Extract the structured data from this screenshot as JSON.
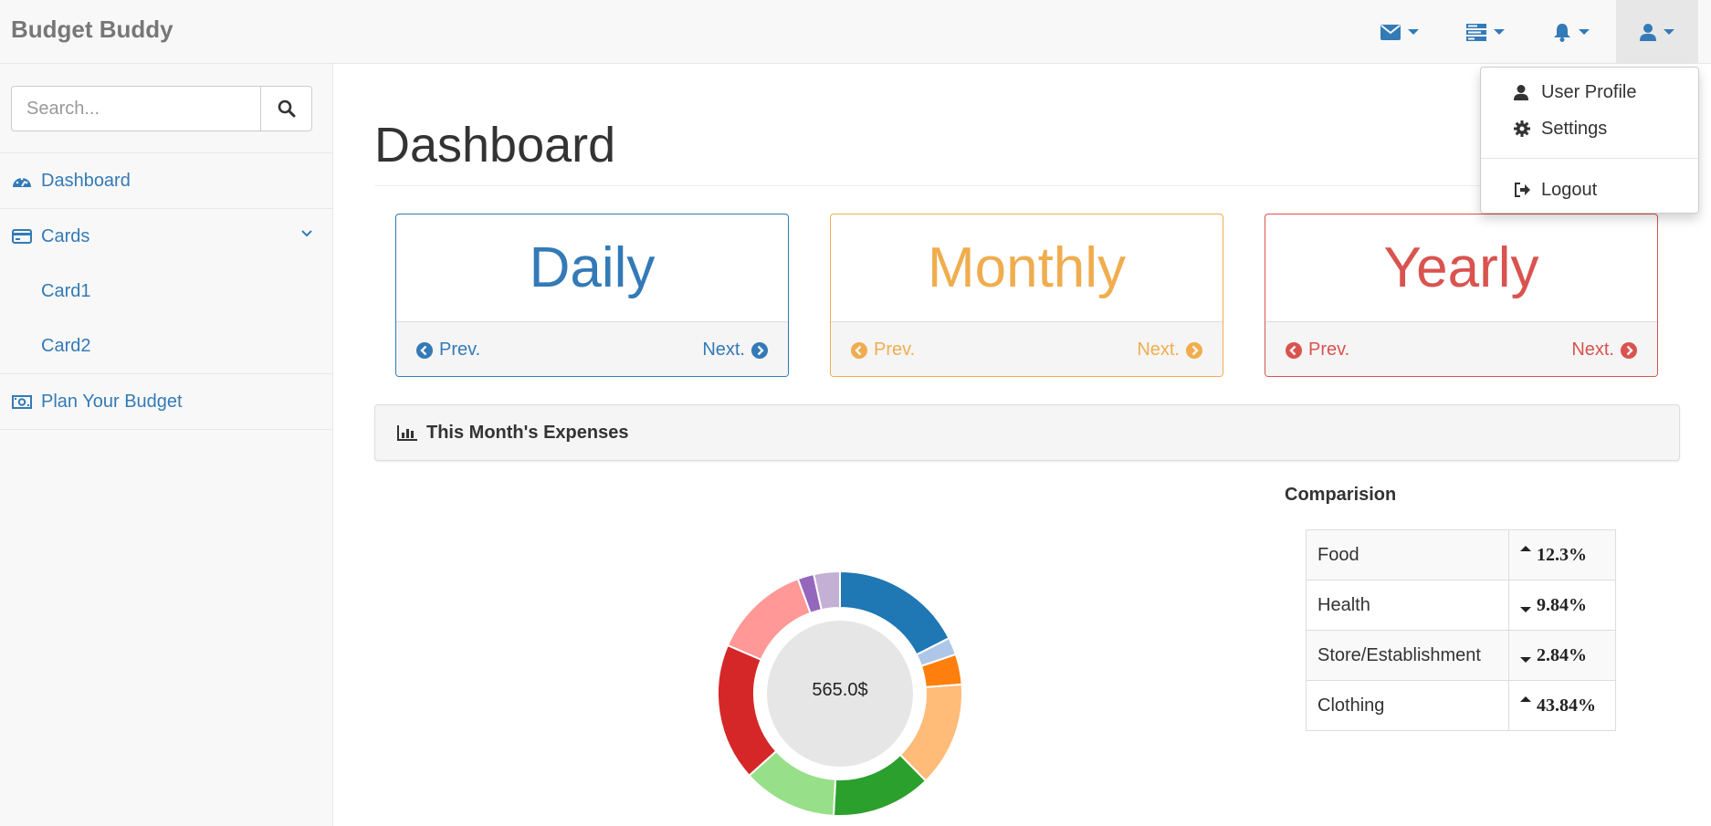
{
  "app": {
    "brand": "Budget Buddy"
  },
  "topnav": [
    {
      "icon": "envelope-icon"
    },
    {
      "icon": "tasks-icon"
    },
    {
      "icon": "bell-icon"
    },
    {
      "icon": "user-icon",
      "active": true
    }
  ],
  "user_menu": {
    "items": [
      {
        "label": "User Profile",
        "icon": "user-icon"
      },
      {
        "label": "Settings",
        "icon": "gear-icon"
      },
      {
        "label": "Logout",
        "icon": "sign-out-icon"
      }
    ]
  },
  "sidebar": {
    "search": {
      "placeholder": "Search..."
    },
    "items": [
      {
        "label": "Dashboard",
        "icon": "dashboard-icon"
      },
      {
        "label": "Cards",
        "icon": "credit-card-icon",
        "expanded": true,
        "children": [
          {
            "label": "Card1"
          },
          {
            "label": "Card2"
          }
        ]
      },
      {
        "label": "Plan Your Budget",
        "icon": "money-icon"
      }
    ]
  },
  "main": {
    "title": "Dashboard",
    "panels": [
      {
        "label": "Daily",
        "prev": "Prev.",
        "next": "Next.",
        "color": "#337ab7"
      },
      {
        "label": "Monthly",
        "prev": "Prev.",
        "next": "Next.",
        "color": "#f0ad4e"
      },
      {
        "label": "Yearly",
        "prev": "Prev.",
        "next": "Next.",
        "color": "#d9534f"
      }
    ],
    "expenses_header": "This Month's Expenses",
    "comparison": {
      "title": "Comparision",
      "rows": [
        {
          "category": "Food",
          "direction": "up",
          "value": "12.3%"
        },
        {
          "category": "Health",
          "direction": "down",
          "value": "9.84%"
        },
        {
          "category": "Store/Establishment",
          "direction": "down",
          "value": "2.84%"
        },
        {
          "category": "Clothing",
          "direction": "up",
          "value": "43.84%"
        }
      ]
    }
  },
  "chart_data": {
    "type": "pie",
    "donut": true,
    "center_label": "565.0$",
    "series": [
      {
        "values": [
          74.2,
          9.7,
          17.0,
          58.6,
          56.0,
          52.9,
          77.0,
          54.8,
          9.1,
          14.6
        ]
      }
    ],
    "colors": [
      "#1f77b4",
      "#aec7e8",
      "#ff7f0e",
      "#ffbb78",
      "#2ca02c",
      "#98df8a",
      "#d62728",
      "#ff9896",
      "#9467bd",
      "#c5b0d5"
    ]
  }
}
